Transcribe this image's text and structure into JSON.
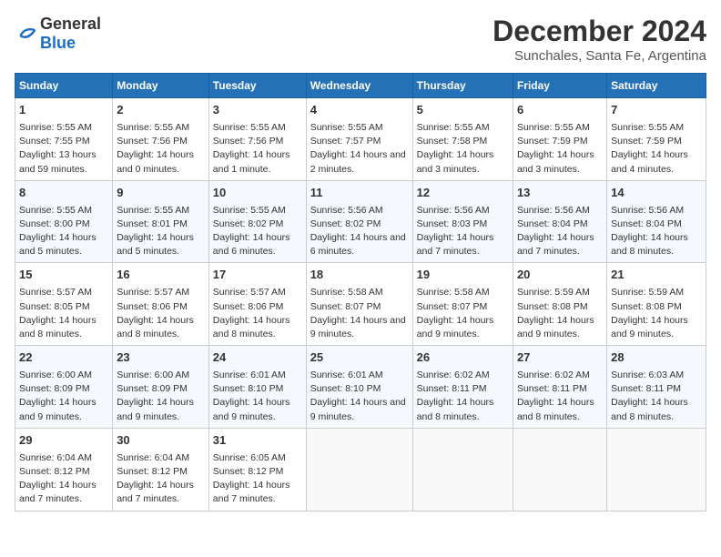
{
  "logo": {
    "general": "General",
    "blue": "Blue"
  },
  "title": "December 2024",
  "location": "Sunchales, Santa Fe, Argentina",
  "days_of_week": [
    "Sunday",
    "Monday",
    "Tuesday",
    "Wednesday",
    "Thursday",
    "Friday",
    "Saturday"
  ],
  "weeks": [
    [
      {
        "day": 1,
        "sunrise": "5:55 AM",
        "sunset": "7:55 PM",
        "daylight": "13 hours and 59 minutes."
      },
      {
        "day": 2,
        "sunrise": "5:55 AM",
        "sunset": "7:56 PM",
        "daylight": "14 hours and 0 minutes."
      },
      {
        "day": 3,
        "sunrise": "5:55 AM",
        "sunset": "7:56 PM",
        "daylight": "14 hours and 1 minute."
      },
      {
        "day": 4,
        "sunrise": "5:55 AM",
        "sunset": "7:57 PM",
        "daylight": "14 hours and 2 minutes."
      },
      {
        "day": 5,
        "sunrise": "5:55 AM",
        "sunset": "7:58 PM",
        "daylight": "14 hours and 3 minutes."
      },
      {
        "day": 6,
        "sunrise": "5:55 AM",
        "sunset": "7:59 PM",
        "daylight": "14 hours and 3 minutes."
      },
      {
        "day": 7,
        "sunrise": "5:55 AM",
        "sunset": "7:59 PM",
        "daylight": "14 hours and 4 minutes."
      }
    ],
    [
      {
        "day": 8,
        "sunrise": "5:55 AM",
        "sunset": "8:00 PM",
        "daylight": "14 hours and 5 minutes."
      },
      {
        "day": 9,
        "sunrise": "5:55 AM",
        "sunset": "8:01 PM",
        "daylight": "14 hours and 5 minutes."
      },
      {
        "day": 10,
        "sunrise": "5:55 AM",
        "sunset": "8:02 PM",
        "daylight": "14 hours and 6 minutes."
      },
      {
        "day": 11,
        "sunrise": "5:56 AM",
        "sunset": "8:02 PM",
        "daylight": "14 hours and 6 minutes."
      },
      {
        "day": 12,
        "sunrise": "5:56 AM",
        "sunset": "8:03 PM",
        "daylight": "14 hours and 7 minutes."
      },
      {
        "day": 13,
        "sunrise": "5:56 AM",
        "sunset": "8:04 PM",
        "daylight": "14 hours and 7 minutes."
      },
      {
        "day": 14,
        "sunrise": "5:56 AM",
        "sunset": "8:04 PM",
        "daylight": "14 hours and 8 minutes."
      }
    ],
    [
      {
        "day": 15,
        "sunrise": "5:57 AM",
        "sunset": "8:05 PM",
        "daylight": "14 hours and 8 minutes."
      },
      {
        "day": 16,
        "sunrise": "5:57 AM",
        "sunset": "8:06 PM",
        "daylight": "14 hours and 8 minutes."
      },
      {
        "day": 17,
        "sunrise": "5:57 AM",
        "sunset": "8:06 PM",
        "daylight": "14 hours and 8 minutes."
      },
      {
        "day": 18,
        "sunrise": "5:58 AM",
        "sunset": "8:07 PM",
        "daylight": "14 hours and 9 minutes."
      },
      {
        "day": 19,
        "sunrise": "5:58 AM",
        "sunset": "8:07 PM",
        "daylight": "14 hours and 9 minutes."
      },
      {
        "day": 20,
        "sunrise": "5:59 AM",
        "sunset": "8:08 PM",
        "daylight": "14 hours and 9 minutes."
      },
      {
        "day": 21,
        "sunrise": "5:59 AM",
        "sunset": "8:08 PM",
        "daylight": "14 hours and 9 minutes."
      }
    ],
    [
      {
        "day": 22,
        "sunrise": "6:00 AM",
        "sunset": "8:09 PM",
        "daylight": "14 hours and 9 minutes."
      },
      {
        "day": 23,
        "sunrise": "6:00 AM",
        "sunset": "8:09 PM",
        "daylight": "14 hours and 9 minutes."
      },
      {
        "day": 24,
        "sunrise": "6:01 AM",
        "sunset": "8:10 PM",
        "daylight": "14 hours and 9 minutes."
      },
      {
        "day": 25,
        "sunrise": "6:01 AM",
        "sunset": "8:10 PM",
        "daylight": "14 hours and 9 minutes."
      },
      {
        "day": 26,
        "sunrise": "6:02 AM",
        "sunset": "8:11 PM",
        "daylight": "14 hours and 8 minutes."
      },
      {
        "day": 27,
        "sunrise": "6:02 AM",
        "sunset": "8:11 PM",
        "daylight": "14 hours and 8 minutes."
      },
      {
        "day": 28,
        "sunrise": "6:03 AM",
        "sunset": "8:11 PM",
        "daylight": "14 hours and 8 minutes."
      }
    ],
    [
      {
        "day": 29,
        "sunrise": "6:04 AM",
        "sunset": "8:12 PM",
        "daylight": "14 hours and 7 minutes."
      },
      {
        "day": 30,
        "sunrise": "6:04 AM",
        "sunset": "8:12 PM",
        "daylight": "14 hours and 7 minutes."
      },
      {
        "day": 31,
        "sunrise": "6:05 AM",
        "sunset": "8:12 PM",
        "daylight": "14 hours and 7 minutes."
      },
      null,
      null,
      null,
      null
    ]
  ]
}
